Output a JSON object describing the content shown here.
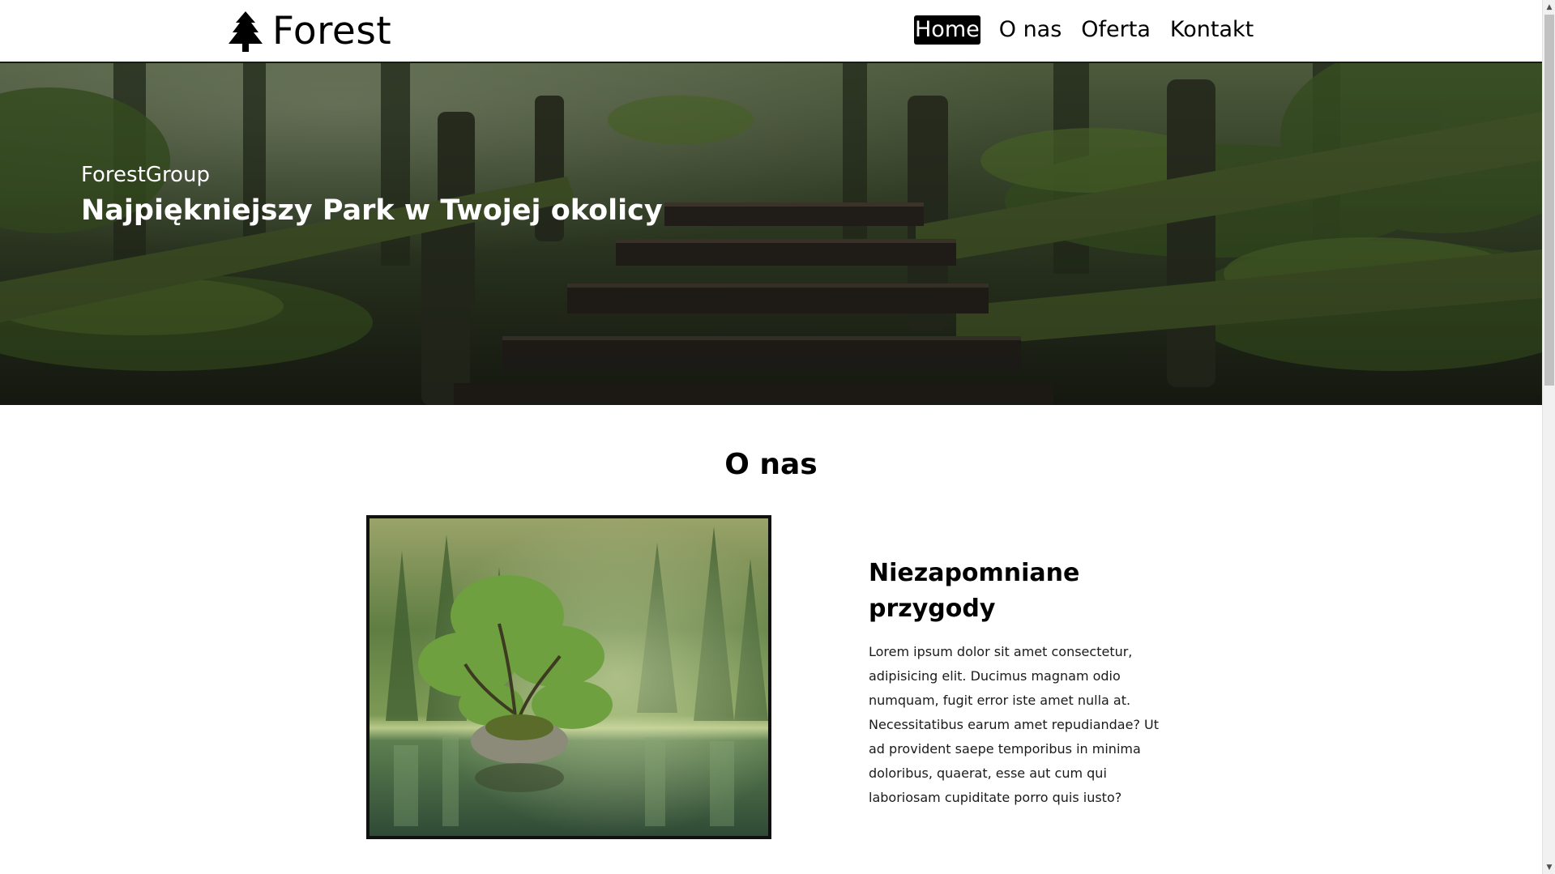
{
  "navbar": {
    "brand": {
      "icon": "tree-icon",
      "text": "Forest"
    },
    "links": [
      {
        "label": "Home",
        "active": true
      },
      {
        "label": "O nas",
        "active": false
      },
      {
        "label": "Oferta",
        "active": false
      },
      {
        "label": "Kontakt",
        "active": false
      }
    ]
  },
  "hero": {
    "subtitle": "ForestGroup",
    "title": "Najpiękniejszy Park w Twojej okolicy",
    "background_image": "forest-bridge-photo"
  },
  "about": {
    "heading": "O nas",
    "image": "tree-island-lake-photo",
    "title": "Niezapomniane przygody",
    "body": "Lorem ipsum dolor sit amet consectetur, adipisicing elit. Ducimus magnam odio numquam, fugit error iste amet nulla at. Necessitatibus earum amet repudiandae? Ut ad provident saepe temporibus in minima doloribus, quaerat, esse aut cum qui laboriosam cupiditate porro quis iusto?"
  },
  "scrollbar": {
    "up_icon": "scroll-up-arrow-icon",
    "down_icon": "scroll-down-arrow-icon"
  }
}
